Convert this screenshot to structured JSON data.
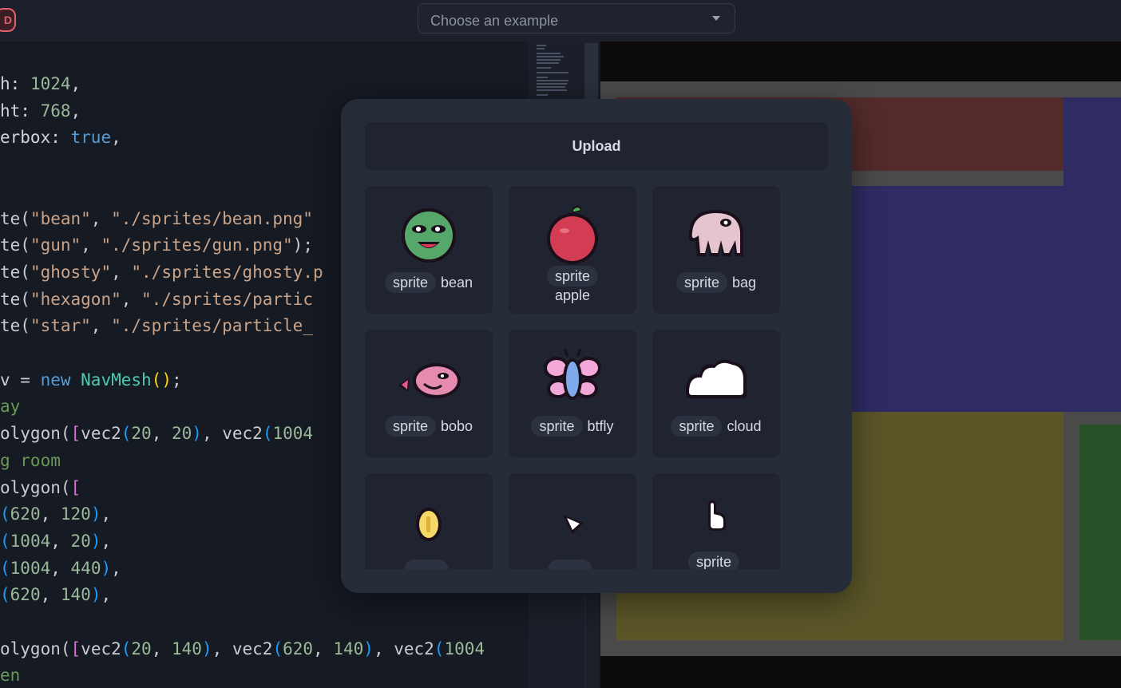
{
  "topbar": {
    "logo_letter": "D",
    "example_select": {
      "placeholder": "Choose an example"
    }
  },
  "editor": {
    "lines": [
      [
        [
          "h: ",
          "t-key"
        ],
        [
          "1024",
          "t-num"
        ],
        [
          ",",
          "t-p"
        ]
      ],
      [
        [
          "ht: ",
          "t-key"
        ],
        [
          "768",
          "t-num"
        ],
        [
          ",",
          "t-p"
        ]
      ],
      [
        [
          "erbox: ",
          "t-key"
        ],
        [
          "true",
          "t-bool"
        ],
        [
          ",",
          "t-p"
        ]
      ],
      [],
      [],
      [
        [
          "te(",
          "t-fn"
        ],
        [
          "\"bean\"",
          "t-str"
        ],
        [
          ", ",
          "t-p"
        ],
        [
          "\"./sprites/bean.png\"",
          "t-str"
        ]
      ],
      [
        [
          "te(",
          "t-fn"
        ],
        [
          "\"gun\"",
          "t-str"
        ],
        [
          ", ",
          "t-p"
        ],
        [
          "\"./sprites/gun.png\"",
          "t-str"
        ],
        [
          ");",
          "t-p"
        ]
      ],
      [
        [
          "te(",
          "t-fn"
        ],
        [
          "\"ghosty\"",
          "t-str"
        ],
        [
          ", ",
          "t-p"
        ],
        [
          "\"./sprites/ghosty.p",
          "t-str"
        ]
      ],
      [
        [
          "te(",
          "t-fn"
        ],
        [
          "\"hexagon\"",
          "t-str"
        ],
        [
          ", ",
          "t-p"
        ],
        [
          "\"./sprites/partic",
          "t-str"
        ]
      ],
      [
        [
          "te(",
          "t-fn"
        ],
        [
          "\"star\"",
          "t-str"
        ],
        [
          ", ",
          "t-p"
        ],
        [
          "\"./sprites/particle_",
          "t-str"
        ]
      ],
      [],
      [
        [
          "v = ",
          "t-p"
        ],
        [
          "new ",
          "t-kw"
        ],
        [
          "NavMesh",
          "t-cls"
        ],
        [
          "()",
          "t-b1"
        ],
        [
          ";",
          "t-p"
        ]
      ],
      [
        [
          "ay",
          "t-cm"
        ]
      ],
      [
        [
          "olygon(",
          "t-fn"
        ],
        [
          "[",
          "t-b2"
        ],
        [
          "vec2",
          "t-fn"
        ],
        [
          "(",
          "t-b3"
        ],
        [
          "20",
          "t-num"
        ],
        [
          ", ",
          "t-p"
        ],
        [
          "20",
          "t-num"
        ],
        [
          ")",
          "t-b3"
        ],
        [
          ", vec2",
          "t-p"
        ],
        [
          "(",
          "t-b3"
        ],
        [
          "1004",
          "t-num"
        ]
      ],
      [
        [
          "g room",
          "t-cm"
        ]
      ],
      [
        [
          "olygon(",
          "t-fn"
        ],
        [
          "[",
          "t-b2"
        ]
      ],
      [
        [
          "(",
          "t-b3"
        ],
        [
          "620",
          "t-num"
        ],
        [
          ", ",
          "t-p"
        ],
        [
          "120",
          "t-num"
        ],
        [
          ")",
          "t-b3"
        ],
        [
          ",",
          "t-p"
        ]
      ],
      [
        [
          "(",
          "t-b3"
        ],
        [
          "1004",
          "t-num"
        ],
        [
          ", ",
          "t-p"
        ],
        [
          "20",
          "t-num"
        ],
        [
          ")",
          "t-b3"
        ],
        [
          ",",
          "t-p"
        ]
      ],
      [
        [
          "(",
          "t-b3"
        ],
        [
          "1004",
          "t-num"
        ],
        [
          ", ",
          "t-p"
        ],
        [
          "440",
          "t-num"
        ],
        [
          ")",
          "t-b3"
        ],
        [
          ",",
          "t-p"
        ]
      ],
      [
        [
          "(",
          "t-b3"
        ],
        [
          "620",
          "t-num"
        ],
        [
          ", ",
          "t-p"
        ],
        [
          "140",
          "t-num"
        ],
        [
          ")",
          "t-b3"
        ],
        [
          ",",
          "t-p"
        ]
      ],
      [],
      [
        [
          "olygon(",
          "t-fn"
        ],
        [
          "[",
          "t-b2"
        ],
        [
          "vec2",
          "t-fn"
        ],
        [
          "(",
          "t-b3"
        ],
        [
          "20",
          "t-num"
        ],
        [
          ", ",
          "t-p"
        ],
        [
          "140",
          "t-num"
        ],
        [
          ")",
          "t-b3"
        ],
        [
          ", vec2",
          "t-p"
        ],
        [
          "(",
          "t-b3"
        ],
        [
          "620",
          "t-num"
        ],
        [
          ", ",
          "t-p"
        ],
        [
          "140",
          "t-num"
        ],
        [
          ")",
          "t-b3"
        ],
        [
          ", vec2",
          "t-p"
        ],
        [
          "(",
          "t-b3"
        ],
        [
          "1004",
          "t-num"
        ]
      ],
      [
        [
          "en",
          "t-cm"
        ]
      ]
    ]
  },
  "modal": {
    "upload_label": "Upload",
    "assets": [
      {
        "kind": "sprite",
        "name": "bean",
        "icon": "bean-icon"
      },
      {
        "kind": "sprite",
        "name": "apple",
        "icon": "apple-icon"
      },
      {
        "kind": "sprite",
        "name": "bag",
        "icon": "bag-icon"
      },
      {
        "kind": "sprite",
        "name": "bobo",
        "icon": "bobo-icon"
      },
      {
        "kind": "sprite",
        "name": "btfly",
        "icon": "btfly-icon"
      },
      {
        "kind": "sprite",
        "name": "cloud",
        "icon": "cloud-icon"
      },
      {
        "kind": "",
        "name": "",
        "icon": "coin-icon"
      },
      {
        "kind": "",
        "name": "",
        "icon": "arrow-icon"
      },
      {
        "kind": "sprite",
        "name": "",
        "icon": "cursor-icon"
      }
    ]
  },
  "colors": {
    "game_red": "#532b2b",
    "game_blue": "#2e2c63",
    "game_yellow": "#5a5628",
    "game_green": "#295229",
    "wall_gray": "#4a4a4a"
  }
}
